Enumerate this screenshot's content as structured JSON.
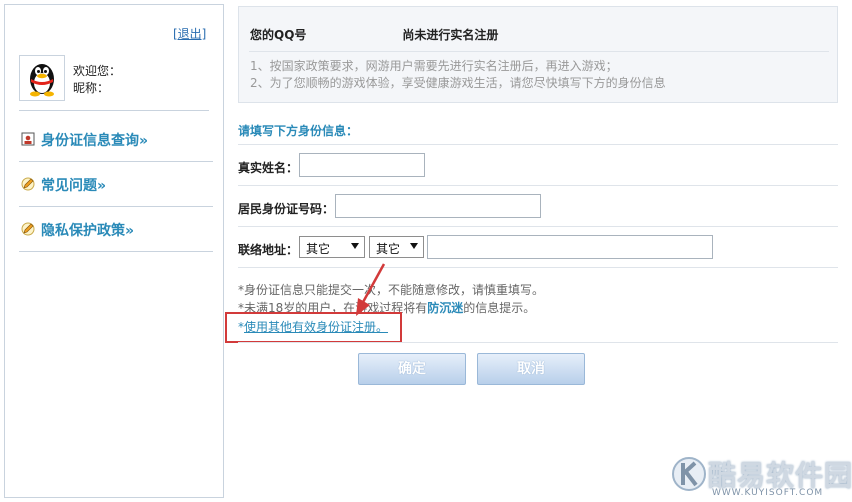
{
  "sidebar": {
    "logout_label": "[退出]",
    "welcome_label": "欢迎您：",
    "nickname_label": "昵称：",
    "avatar_icon": "qq-penguin-icon",
    "items": [
      {
        "label": "身份证信息查询»",
        "icon": "id-card-icon"
      },
      {
        "label": "常见问题»",
        "icon": "pencil-icon"
      },
      {
        "label": "隐私保护政策»",
        "icon": "pencil-icon"
      }
    ]
  },
  "notice": {
    "title_prefix": "您的QQ号",
    "title_suffix": "尚未进行实名注册",
    "lines": [
      "1、按国家政策要求，网游用户需要先进行实名注册后，再进入游戏；",
      "2、为了您顺畅的游戏体验，享受健康游戏生活，请您尽快填写下方的身份信息"
    ]
  },
  "form": {
    "heading": "请填写下方身份信息：",
    "name_label": "真实姓名：",
    "name_value": "",
    "id_label": "居民身份证号码：",
    "id_value": "",
    "address_label": "联络地址：",
    "province_selected": "其它",
    "city_selected": "其它",
    "address_value": ""
  },
  "notes": {
    "line1": "*身份证信息只能提交一次，不能随意修改，请慎重填写。",
    "line2_a": "*未满18岁的用户，在游戏过程将有",
    "line2_b": "防沉迷",
    "line2_c": "的信息提示。",
    "line3_star": "*",
    "line3_link": "使用其他有效身份证注册。"
  },
  "buttons": {
    "confirm": "确定",
    "cancel": "取消"
  },
  "watermark": {
    "text": "酷易软件园",
    "url": "WWW.KUYISOFT.COM"
  },
  "colors": {
    "accent": "#2a8ab8",
    "highlight": "#d23a3a",
    "border": "#c9d3de"
  }
}
